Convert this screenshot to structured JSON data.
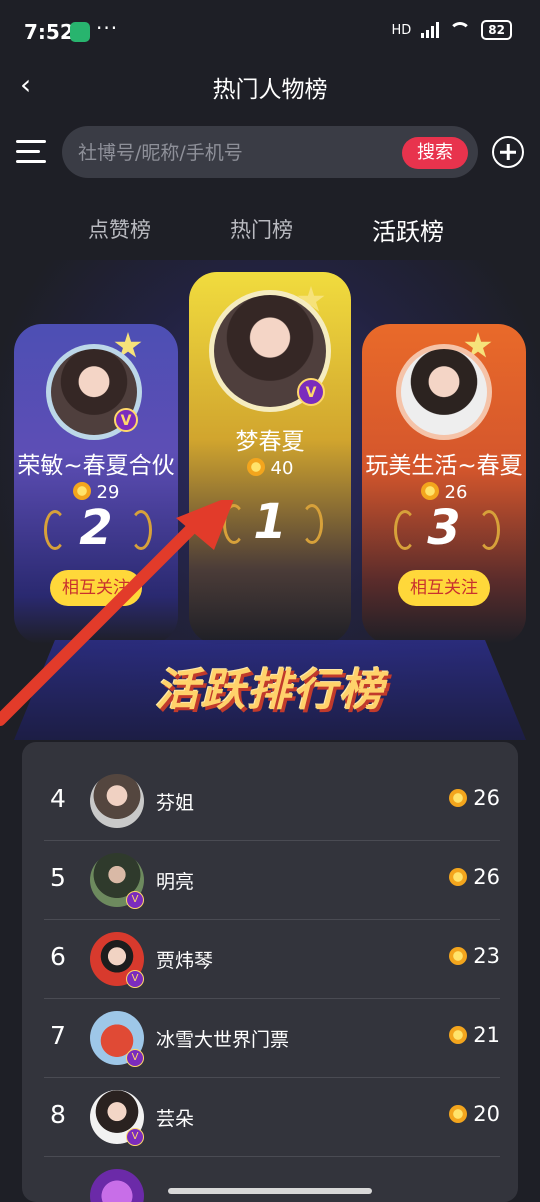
{
  "status": {
    "time": "7:52",
    "more": "···",
    "battery": "82",
    "hd": "HD"
  },
  "header": {
    "title": "热门人物榜"
  },
  "search": {
    "placeholder": "社博号/昵称/手机号",
    "button": "搜索"
  },
  "tabs": [
    {
      "label": "点赞榜",
      "active": false
    },
    {
      "label": "热门榜",
      "active": false
    },
    {
      "label": "活跃榜",
      "active": true
    }
  ],
  "podium": [
    {
      "rank": "2",
      "name": "荣敏~春夏合伙",
      "score": "29",
      "follow": "相互关注"
    },
    {
      "rank": "1",
      "name": "梦春夏",
      "score": "40"
    },
    {
      "rank": "3",
      "name": "玩美生活~春夏",
      "score": "26",
      "follow": "相互关注"
    }
  ],
  "banner": "活跃排行榜",
  "list": [
    {
      "rank": "4",
      "name": "芬姐",
      "score": "26"
    },
    {
      "rank": "5",
      "name": "明亮",
      "score": "26"
    },
    {
      "rank": "6",
      "name": "贾炜琴",
      "score": "23"
    },
    {
      "rank": "7",
      "name": "冰雪大世界门票",
      "score": "21"
    },
    {
      "rank": "8",
      "name": "芸朵",
      "score": "20"
    }
  ],
  "colors": {
    "accent": "#e8334d",
    "gold": "#ffd83a",
    "vip": "#7b2cbd"
  },
  "icons": [
    "back-arrow-icon",
    "menu-icon",
    "plus-circle-icon",
    "coin-icon",
    "v-badge-icon",
    "laurel-icon",
    "crown-star-icon"
  ]
}
